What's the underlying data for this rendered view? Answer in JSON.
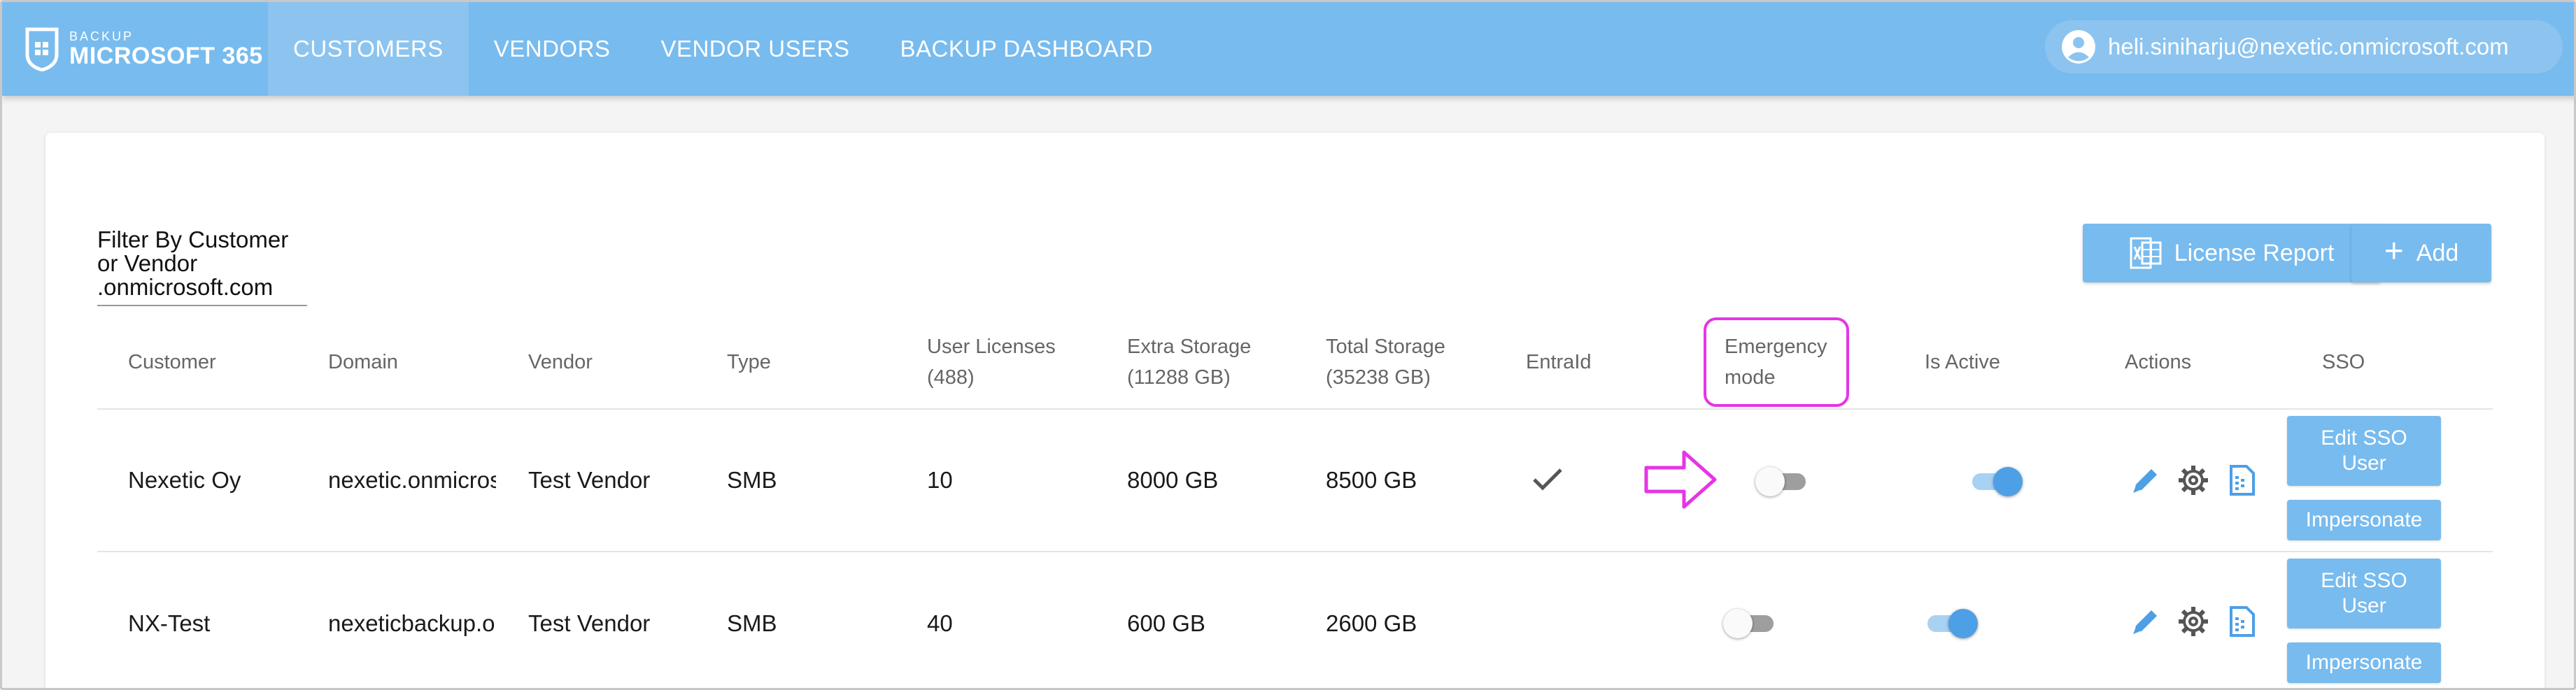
{
  "header": {
    "brand_small": "BACKUP",
    "brand_big": "MICROSOFT 365",
    "nav": [
      {
        "label": "CUSTOMERS",
        "active": true
      },
      {
        "label": "VENDORS",
        "active": false
      },
      {
        "label": "VENDOR USERS",
        "active": false
      },
      {
        "label": "BACKUP DASHBOARD",
        "active": false
      }
    ],
    "user_email": "heli.siniharju@nexetic.onmicrosoft.com"
  },
  "toolbar": {
    "filter_line1": "Filter By Customer or Vendor",
    "filter_line2": ".onmicrosoft.com",
    "license_report_label": "License Report",
    "add_label": "Add"
  },
  "table": {
    "headers": {
      "customer": "Customer",
      "domain": "Domain",
      "vendor": "Vendor",
      "type": "Type",
      "user_licenses": "User Licenses",
      "user_licenses_total": "(488)",
      "extra_storage": "Extra Storage",
      "extra_storage_total": "(11288 GB)",
      "total_storage": "Total Storage",
      "total_storage_total": "(35238 GB)",
      "entraid": "EntraId",
      "emergency_line1": "Emergency",
      "emergency_line2": "mode",
      "is_active": "Is Active",
      "actions": "Actions",
      "sso": "SSO"
    },
    "rows": [
      {
        "customer": "Nexetic Oy",
        "domain": "nexetic.onmicrosoft.com",
        "vendor": "Test Vendor",
        "type": "SMB",
        "user_licenses": "10",
        "extra_storage": "8000 GB",
        "total_storage": "8500 GB",
        "entraid": true,
        "emergency_mode": false,
        "is_active": true,
        "sso_edit_label": "Edit SSO User",
        "sso_impersonate_label": "Impersonate"
      },
      {
        "customer": "NX-Test",
        "domain": "nexeticbackup.onmicrosoft.com",
        "vendor": "Test Vendor",
        "type": "SMB",
        "user_licenses": "40",
        "extra_storage": "600 GB",
        "total_storage": "2600 GB",
        "entraid": false,
        "emergency_mode": false,
        "is_active": true,
        "sso_edit_label": "Edit SSO User",
        "sso_impersonate_label": "Impersonate"
      }
    ]
  },
  "icons": {
    "entraid_check": "check-icon",
    "edit": "pencil-icon",
    "settings": "gear-icon",
    "report": "document-icon"
  },
  "colors": {
    "header_bg": "#78bbee",
    "accent": "#4d9fe6",
    "highlight": "#e535e5"
  }
}
